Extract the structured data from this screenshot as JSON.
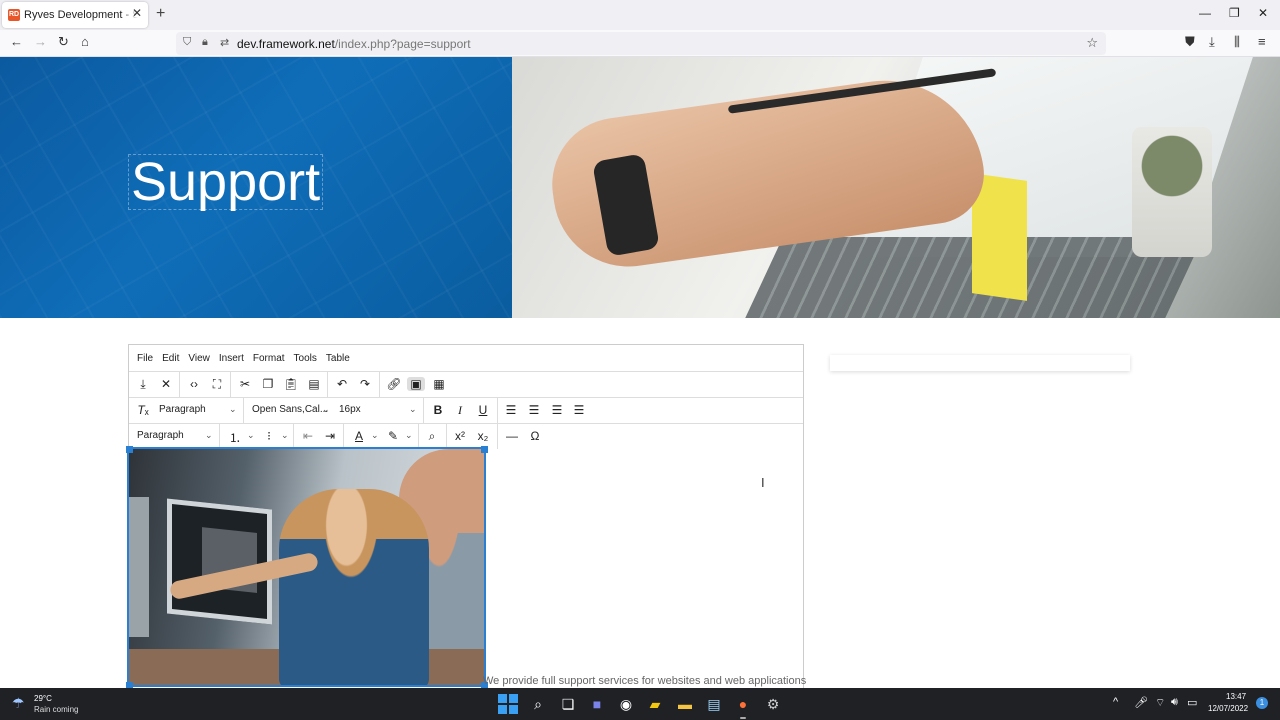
{
  "browser": {
    "tab_title": "Ryves Development - Support",
    "favicon_text": "RD",
    "url_host": "dev.framework.net",
    "url_path": "/index.php?page=support"
  },
  "page": {
    "hero_title": "Support"
  },
  "editor": {
    "menu": [
      "File",
      "Edit",
      "View",
      "Insert",
      "Format",
      "Tools",
      "Table"
    ],
    "block_format": "Paragraph",
    "font_family": "Open Sans,Cal...",
    "font_size": "16px",
    "style_format": "Paragraph",
    "caption": "We provide full support services for websites and web applications"
  },
  "taskbar": {
    "temperature": "29°C",
    "weather": "Rain coming",
    "time": "13:47",
    "date": "12/07/2022",
    "notifications": "1"
  }
}
